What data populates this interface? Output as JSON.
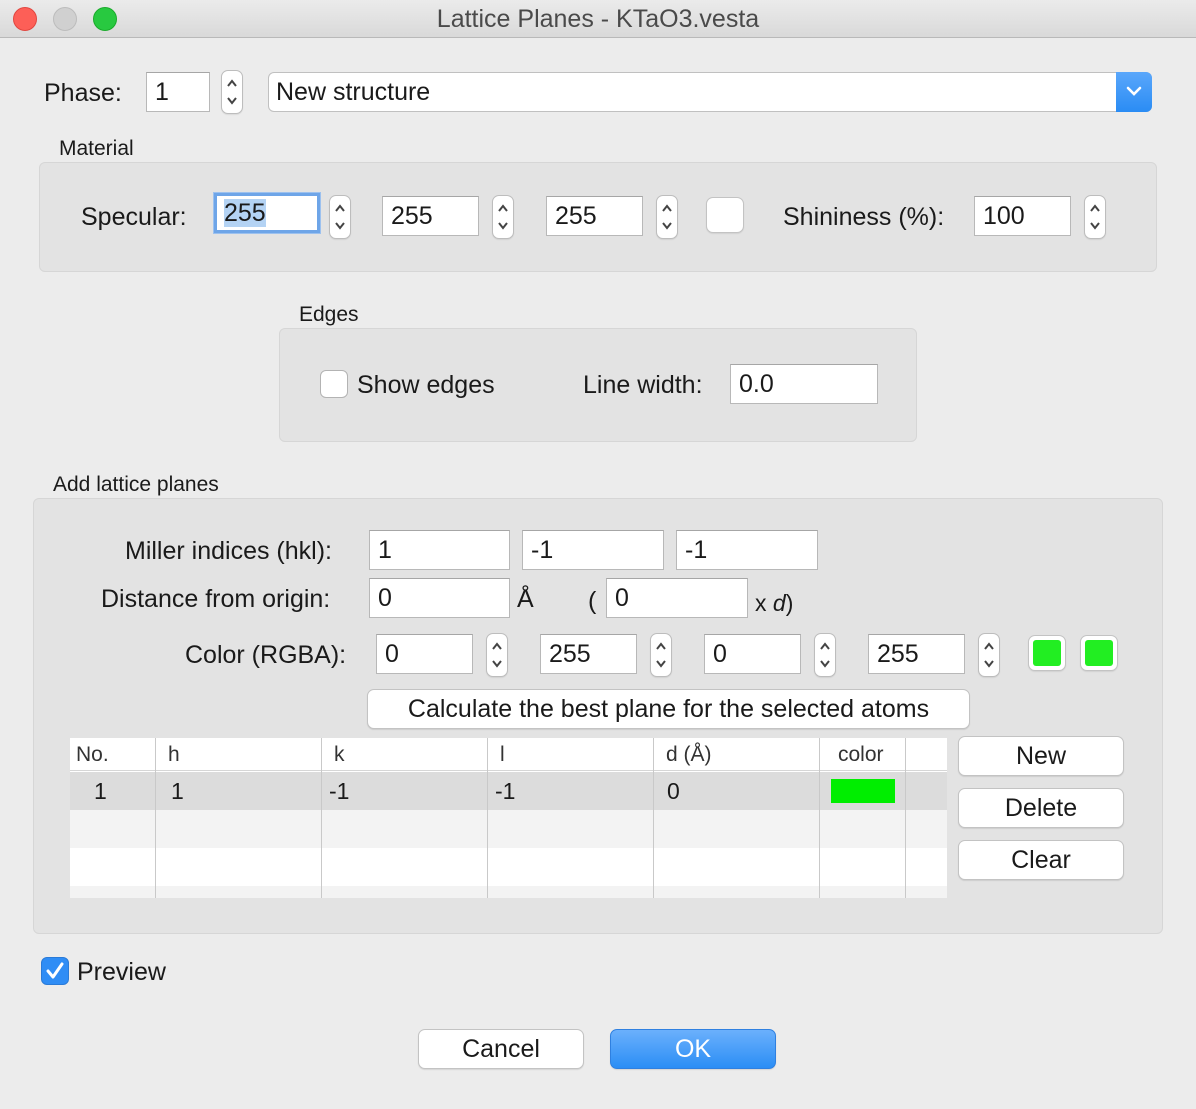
{
  "window": {
    "title": "Lattice Planes - KTaO3.vesta"
  },
  "phase": {
    "label": "Phase:",
    "value": "1",
    "structure": "New structure"
  },
  "material": {
    "section_label": "Material",
    "specular_label": "Specular:",
    "specular": [
      "255",
      "255",
      "255"
    ],
    "shininess_label": "Shininess (%):",
    "shininess": "100"
  },
  "edges": {
    "section_label": "Edges",
    "show_edges_label": "Show edges",
    "show_edges_checked": false,
    "line_width_label": "Line width:",
    "line_width": "0.0"
  },
  "lattice": {
    "section_label": "Add lattice planes",
    "miller_label": "Miller indices (hkl):",
    "miller": [
      "1",
      "-1",
      "-1"
    ],
    "distance_label": "Distance from origin:",
    "distance": "0",
    "angstrom": "Å",
    "paren_open": "(",
    "distance_d": "0",
    "x_label": "x ",
    "d_label": "d",
    "paren_close": ")",
    "color_label": "Color (RGBA):",
    "rgba": [
      "0",
      "255",
      "0",
      "255"
    ],
    "swatch_color": "#22ee22",
    "calc_button": "Calculate the best plane for the selected atoms",
    "table": {
      "headers": [
        "No.",
        "h",
        "k",
        "l",
        "d (Å)",
        "color"
      ],
      "rows": [
        {
          "no": "1",
          "h": "1",
          "k": "-1",
          "l": "-1",
          "d": "0",
          "color": "#00ee00"
        }
      ]
    },
    "new_button": "New",
    "delete_button": "Delete",
    "clear_button": "Clear"
  },
  "preview": {
    "label": "Preview",
    "checked": true
  },
  "footer": {
    "cancel": "Cancel",
    "ok": "OK"
  },
  "colors": {
    "accent": "#2f8df5",
    "focus_ring": "#6ea5e8",
    "green": "#22ee22"
  }
}
